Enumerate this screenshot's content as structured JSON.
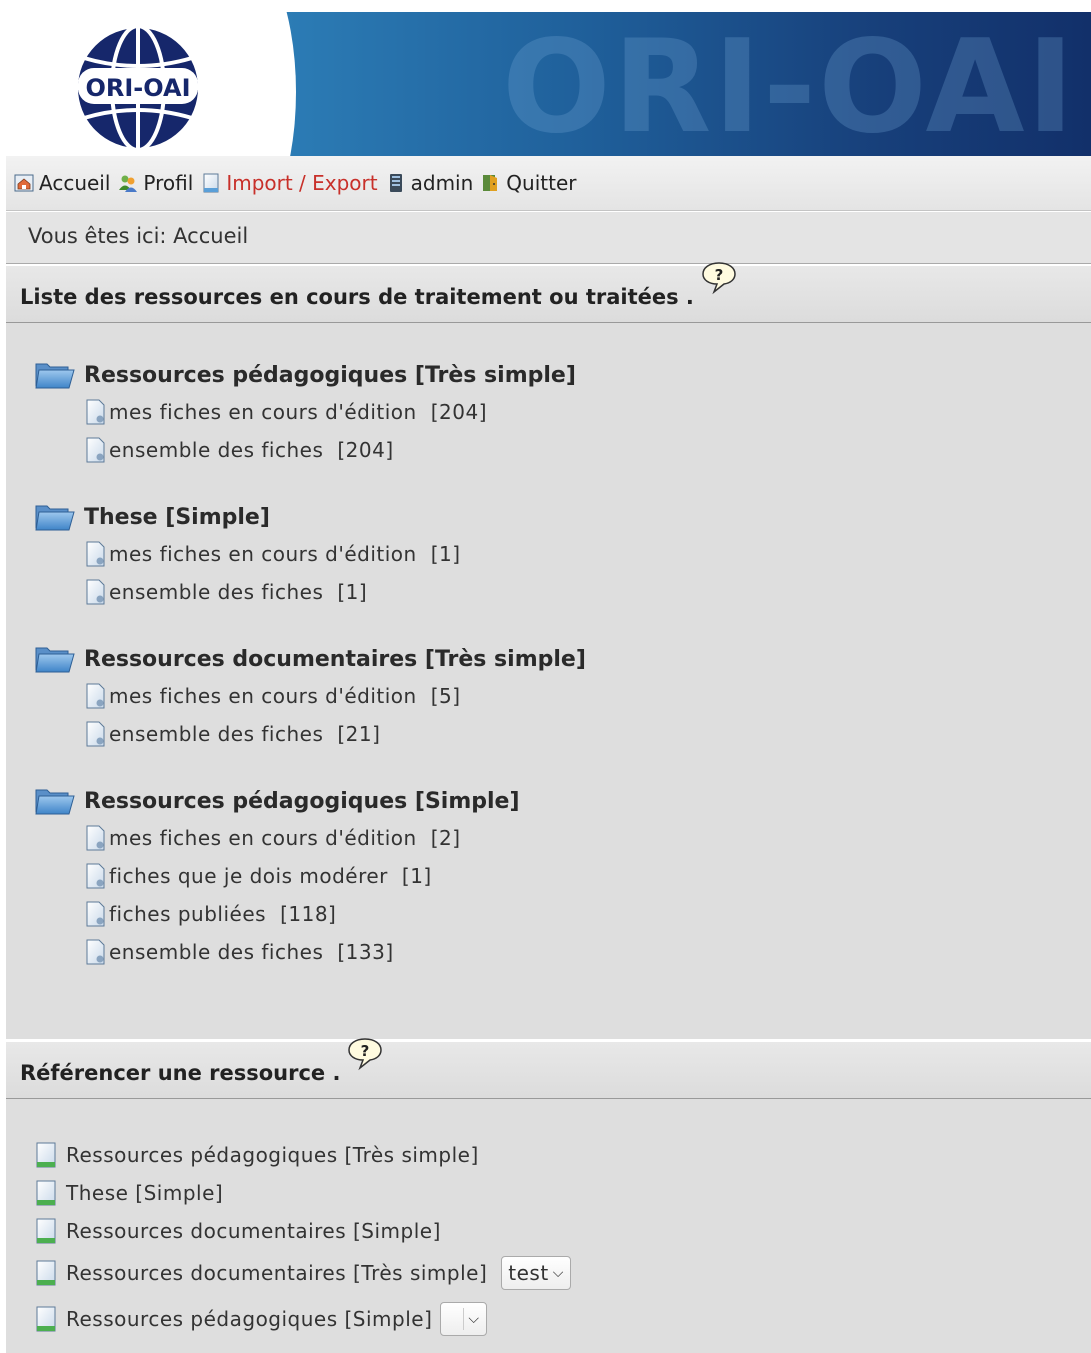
{
  "banner": {
    "brand_text": "ORI-OAI",
    "logo_text": "ORI-OAI"
  },
  "nav": {
    "items": [
      {
        "label": "Accueil",
        "icon": "home-icon"
      },
      {
        "label": "Profil",
        "icon": "users-icon"
      },
      {
        "label": "Import / Export",
        "icon": "document-icon"
      },
      {
        "label": "admin",
        "icon": "server-icon"
      },
      {
        "label": "Quitter",
        "icon": "exit-icon"
      }
    ]
  },
  "breadcrumb": "Vous êtes ici: Accueil",
  "list_section": {
    "title": "Liste des ressources en cours de traitement ou traitées .",
    "groups": [
      {
        "title": "Ressources pédagogiques [Très simple]",
        "items": [
          {
            "label": "mes fiches en cours d'édition",
            "count": "[204]"
          },
          {
            "label": "ensemble des fiches",
            "count": "[204]"
          }
        ]
      },
      {
        "title": "These [Simple]",
        "items": [
          {
            "label": "mes fiches en cours d'édition",
            "count": "[1]"
          },
          {
            "label": "ensemble des fiches",
            "count": "[1]"
          }
        ]
      },
      {
        "title": "Ressources documentaires [Très simple]",
        "items": [
          {
            "label": "mes fiches en cours d'édition",
            "count": "[5]"
          },
          {
            "label": "ensemble des fiches",
            "count": "[21]"
          }
        ]
      },
      {
        "title": "Ressources pédagogiques [Simple]",
        "items": [
          {
            "label": "mes fiches en cours d'édition",
            "count": "[2]"
          },
          {
            "label": "fiches que je dois modérer",
            "count": "[1]"
          },
          {
            "label": "fiches publiées",
            "count": "[118]"
          },
          {
            "label": "ensemble des fiches",
            "count": "[133]"
          }
        ]
      }
    ]
  },
  "reference_section": {
    "title": "Référencer une ressource .",
    "items": [
      {
        "label": "Ressources pédagogiques [Très simple]"
      },
      {
        "label": "These [Simple]"
      },
      {
        "label": "Ressources documentaires [Simple]"
      },
      {
        "label": "Ressources documentaires [Très simple]",
        "select_value": "test"
      },
      {
        "label": "Ressources pédagogiques [Simple]",
        "select_value": ""
      }
    ]
  },
  "help_glyph": "?"
}
